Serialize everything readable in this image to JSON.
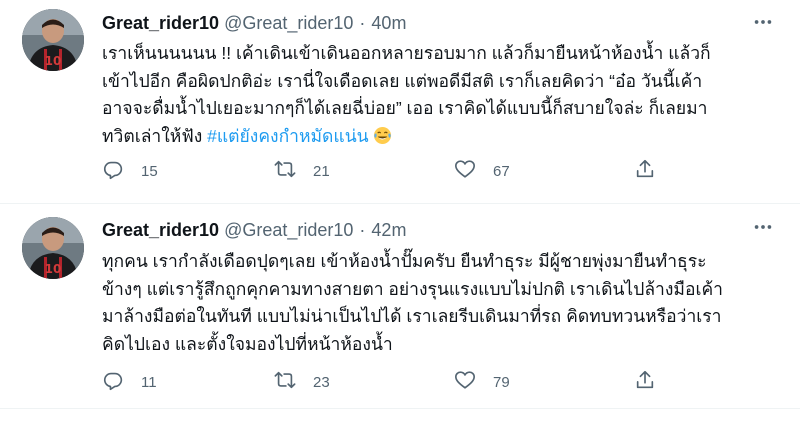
{
  "colors": {
    "text": "#0f1419",
    "secondary": "#536471",
    "accent": "#1d9bf0",
    "divider": "#eff3f4"
  },
  "tweets": [
    {
      "display_name": "Great_rider10",
      "handle": "@Great_rider10",
      "separator": "·",
      "time": "40m",
      "text_lines": [
        "เราเห็นนนนนน !! เค้าเดินเข้าเดินออกหลายรอบมาก แล้วก็มายืนหน้าห้องน้ำ แล้วก็",
        "เข้าไปอีก คือผิดปกติอ่ะ เรานี่ใจเดือดเลย แต่พอดีมีสติ เราก็เลยคิดว่า “อ๋อ วันนี้เค้า",
        "อาจจะดื่มน้ำไปเยอะมากๆก็ได้เลยฉี่บ่อย” เออ เราคิดได้แบบนี้ก็สบายใจล่ะ ก็เลยมา",
        "ทวิตเล่าให้ฟัง "
      ],
      "hashtag": "#แต่ยังคงกำหมัดแน่น",
      "emoji_icon": "joy-emoji-icon",
      "replies": "15",
      "retweets": "21",
      "likes": "67"
    },
    {
      "display_name": "Great_rider10",
      "handle": "@Great_rider10",
      "separator": "·",
      "time": "42m",
      "text_lines": [
        "ทุกคน เรากำลังเดือดปุดๆเลย เข้าห้องน้ำปั๊มครับ ยืนทำธุระ มีผู้ชายพุ่งมายืนทำธุระ",
        "ข้างๆ แต่เรารู้สึกถูกคุกคามทางสายตา อย่างรุนแรงแบบไม่ปกติ เราเดินไปล้างมือเค้า",
        "มาล้างมือต่อในทันที แบบไม่น่าเป็นไปได้ เราเลยรีบเดินมาที่รถ คิดทบทวนหรือว่าเรา",
        "คิดไปเอง และตั้งใจมองไปที่หน้าห้องน้ำ"
      ],
      "replies": "11",
      "retweets": "23",
      "likes": "79"
    }
  ],
  "icons": {
    "reply": "reply-icon",
    "retweet": "retweet-icon",
    "like": "heart-icon",
    "share": "share-icon",
    "more": "more-icon"
  }
}
